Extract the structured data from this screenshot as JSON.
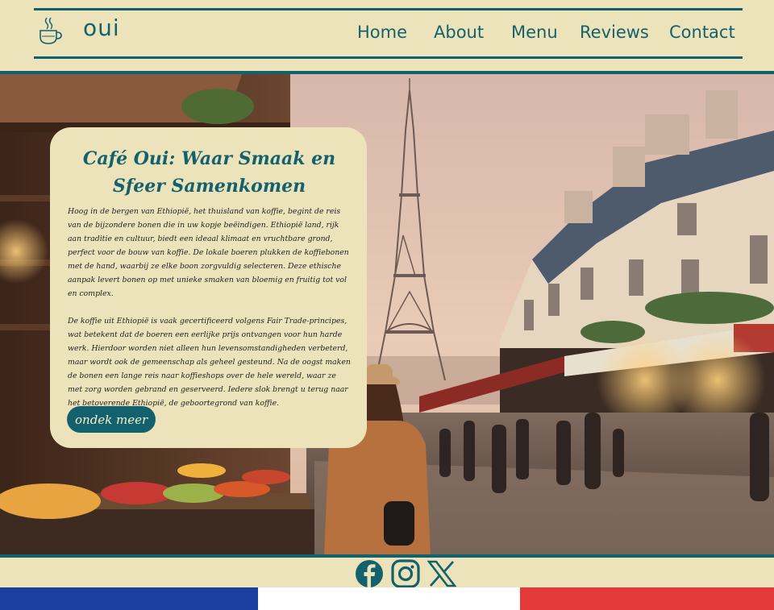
{
  "brand": {
    "logo": "oui",
    "icon": "coffee-cup-icon"
  },
  "nav": {
    "items": [
      "Home",
      "About",
      "Menu",
      "Reviews",
      "Contact"
    ]
  },
  "hero": {
    "title": "Café Oui: Waar Smaak en Sfeer Samenkomen",
    "paragraph1": "Hoog in de bergen van Ethiopië, het thuisland van koffie, begint de reis van de bijzondere bonen die in uw kopje beëindigen. Ethiopië land, rijk aan traditie en cultuur, biedt een ideaal klimaat en vruchtbare grond, perfect voor de bouw van koffie. De lokale boeren plukken de koffiebonen met de hand, waarbij ze elke boon zorgvuldig selecteren. Deze ethische aanpak levert bonen op met unieke smaken van bloemig en fruitig tot vol en complex.",
    "paragraph2": " De koffie uit Ethiopië is vaak gecertificeerd volgens Fair Trade-principes, wat betekent dat de boeren een eerlijke prijs ontvangen voor hun harde werk. Hierdoor worden niet alleen hun levensomstandigheden verbeterd, maar wordt ook de gemeenschap als geheel gesteund. Na de oogst maken de bonen een lange reis naar koffieshops over de hele wereld, waar ze met zorg worden gebrand en geserveerd. Iedere slok brengt u terug naar het betoverende Ethiopië, de geboortegrond van koffie.",
    "cta": "ondek meer",
    "image": "paris-cafe-street-eiffel-tower"
  },
  "social": [
    "facebook-icon",
    "instagram-icon",
    "x-icon"
  ],
  "colors": {
    "accent": "#14616e",
    "background": "#ece3bb",
    "flag": [
      "#1a3fa0",
      "#ffffff",
      "#e43a3a"
    ]
  }
}
